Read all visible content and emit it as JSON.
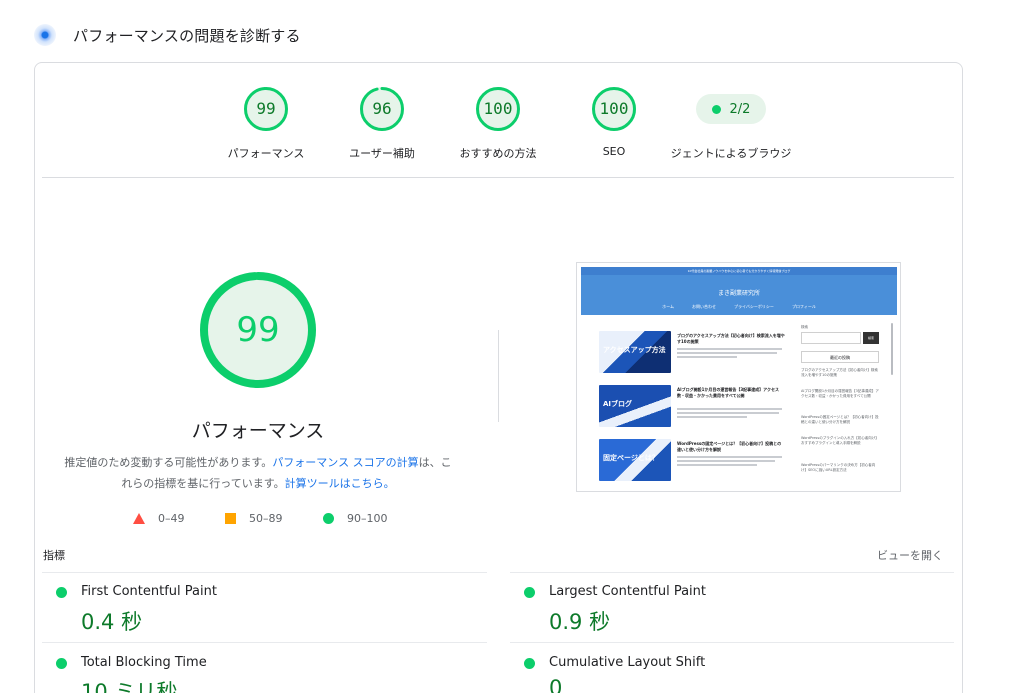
{
  "header": {
    "title": "パフォーマンスの問題を診断する",
    "icon": "diagnostics-icon"
  },
  "colors": {
    "pass": "#0cce6b",
    "pass_text": "#0d7a2a",
    "average": "#ffa400",
    "fail": "#ff4e42",
    "link": "#1a73e8"
  },
  "categories": [
    {
      "score": "99",
      "label": "パフォーマンス",
      "value": 0.99
    },
    {
      "score": "96",
      "label": "ユーザー補助",
      "value": 0.96
    },
    {
      "score": "100",
      "label": "おすすめの方法",
      "value": 1.0
    },
    {
      "score": "100",
      "label": "SEO",
      "value": 1.0
    },
    {
      "score": "2/2",
      "label": "ジェントによるブラウジ"
    }
  ],
  "main_gauge": {
    "score": "99",
    "value": 0.99,
    "label": "パフォーマンス"
  },
  "description": {
    "part1": "推定値のため変動する可能性があります。",
    "link1": "パフォーマンス スコアの計算",
    "part2": "は、これらの指標を基に行っています。",
    "link2": "計算ツールはこちら。"
  },
  "legend": {
    "fail": "0–49",
    "average": "50–89",
    "pass": "90–100"
  },
  "thumbnail": {
    "topbar": "10代会社員の副業ノウハウを中心に初心者でも分かりやすく情報発信ブログ",
    "site_name": "まき副業研究所",
    "nav": [
      "ホーム",
      "お問い合わせ",
      "プライバシーポリシー",
      "プロフィール"
    ],
    "posts": [
      {
        "title": "ブログのアクセスアップ方法【初心者向け】検索流入を増やす10の施策",
        "image_text": "アクセスアップ方法"
      },
      {
        "title": "AIブログ開設1か月目の運営報告【3記事達成】アクセス数・収益・かかった費用をすべて公開",
        "image_text": "AIブログ"
      },
      {
        "title": "WordPressの固定ページとは？【初心者向け】投稿との違いと使い分け方を解説",
        "image_text": "固定ページとは？"
      }
    ],
    "sidebar": {
      "search_label": "検索",
      "search_button": "検索",
      "recent_title": "最近の投稿",
      "recent": [
        "ブログのアクセスアップ方法【初心者向け】検索流入を増やす10の施策",
        "AIブログ開設1か月目の運営報告【3記事達成】アクセス数・収益・かかった費用をすべて公開",
        "WordPressの固定ページとは？【初心者向け】投稿との違いと使い分け方を解説",
        "WordPressのプラグインの入れ方【初心者向け】おすすめプラグインと導入手順を解説",
        "WordPressのパーマリンクの決め方【初心者向け】SEOに強いURL設定方法"
      ]
    }
  },
  "metrics": {
    "label": "指標",
    "toggle": "ビューを開く",
    "items": [
      {
        "name": "First Contentful Paint",
        "value": "0.4 秒"
      },
      {
        "name": "Largest Contentful Paint",
        "value": "0.9 秒"
      },
      {
        "name": "Total Blocking Time",
        "value": "10 ミリ秒"
      },
      {
        "name": "Cumulative Layout Shift",
        "value": "0"
      }
    ]
  }
}
